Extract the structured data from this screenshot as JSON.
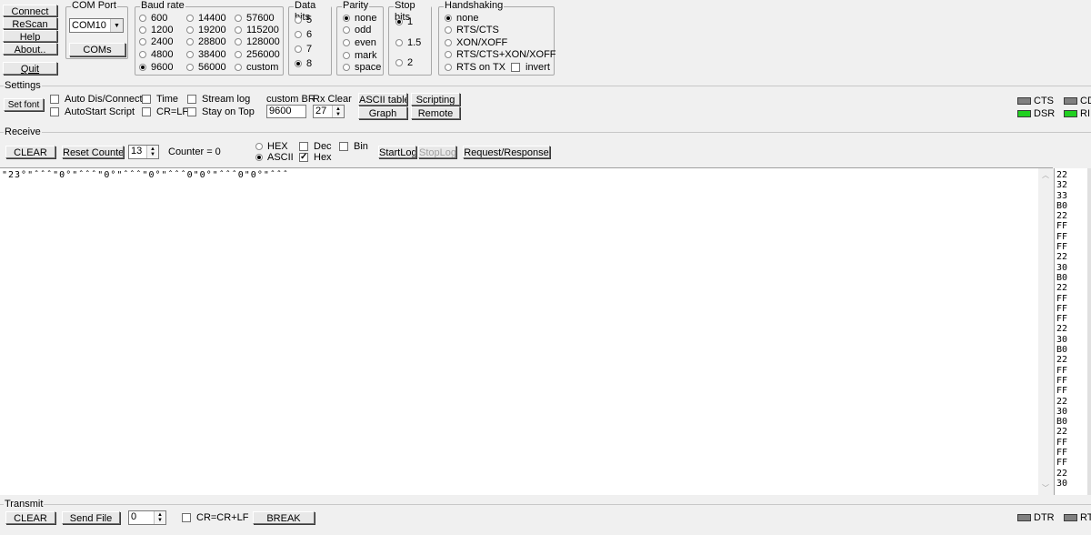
{
  "left_buttons": {
    "connect": "Connect",
    "rescan": "ReScan",
    "help": "Help",
    "about": "About..",
    "quit": "Quit"
  },
  "com_port": {
    "title": "COM Port",
    "value": "COM10",
    "coms_button": "COMs"
  },
  "baud_rate": {
    "title": "Baud rate",
    "options": [
      "600",
      "1200",
      "2400",
      "4800",
      "9600",
      "14400",
      "19200",
      "28800",
      "38400",
      "56000",
      "57600",
      "115200",
      "128000",
      "256000",
      "custom"
    ],
    "selected": "9600"
  },
  "data_bits": {
    "title": "Data bits",
    "options": [
      "5",
      "6",
      "7",
      "8"
    ],
    "selected": "8"
  },
  "parity": {
    "title": "Parity",
    "options": [
      "none",
      "odd",
      "even",
      "mark",
      "space"
    ],
    "selected": "none"
  },
  "stop_bits": {
    "title": "Stop bits",
    "options": [
      "1",
      "1.5",
      "2"
    ],
    "selected": "1"
  },
  "handshaking": {
    "title": "Handshaking",
    "options": [
      "none",
      "RTS/CTS",
      "XON/XOFF",
      "RTS/CTS+XON/XOFF",
      "RTS on TX"
    ],
    "selected": "none",
    "invert": "invert"
  },
  "settings": {
    "title": "Settings",
    "set_font": "Set font",
    "auto_dis_connect": "Auto Dis/Connect",
    "autostart_script": "AutoStart Script",
    "time": "Time",
    "cr_lf": "CR=LF",
    "stream_log": "Stream log",
    "stay_on_top": "Stay on Top",
    "custom_br_label": "custom BR",
    "custom_br_value": "9600",
    "rx_clear_label": "Rx Clear",
    "rx_clear_value": "27",
    "ascii_table": "ASCII table",
    "scripting": "Scripting",
    "graph": "Graph",
    "remote": "Remote"
  },
  "signals": {
    "cts": "CTS",
    "cd": "CD",
    "dsr": "DSR",
    "ri": "RI",
    "dtr": "DTR",
    "rts": "RT",
    "led_off_color": "#808080",
    "led_on_color": "#20d020"
  },
  "receive": {
    "title": "Receive",
    "clear": "CLEAR",
    "reset_counter": "Reset Counter",
    "counter_spin": "13",
    "counter_text": "Counter = 0",
    "hex": "HEX",
    "ascii": "ASCII",
    "dec": "Dec",
    "hex_check": "Hex",
    "bin": "Bin",
    "startlog": "StartLog",
    "stoplog": "StopLog",
    "request_response": "Request/Response",
    "ascii_output": "\"23°\"ˆˆˆ\"0°\"ˆˆˆ\"0°\"ˆˆˆ\"0°\"ˆˆˆ0\"0°\"ˆˆˆ0\"0°\"ˆˆˆ",
    "hex_lines": [
      "22",
      "32",
      "33",
      "B0",
      "22",
      "FF",
      "FF",
      "FF",
      "22",
      "30",
      "B0",
      "22",
      "FF",
      "FF",
      "FF",
      "22",
      "30",
      "B0",
      "22",
      "FF",
      "FF",
      "FF",
      "22",
      "30",
      "B0",
      "22",
      "FF",
      "FF",
      "FF",
      "22",
      "30"
    ]
  },
  "transmit": {
    "title": "Transmit",
    "clear": "CLEAR",
    "send_file": "Send File",
    "spin_value": "0",
    "cr_cr_lf": "CR=CR+LF",
    "break": "BREAK"
  }
}
